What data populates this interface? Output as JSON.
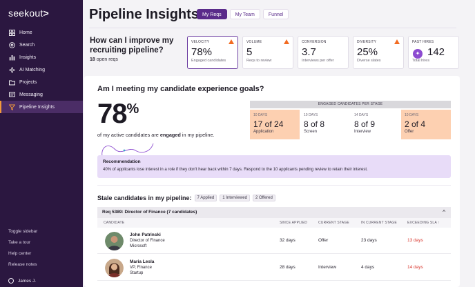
{
  "sidebar": {
    "logo": "seekout",
    "logo_mark": ">",
    "items": [
      {
        "label": "Home",
        "icon": "grid-icon"
      },
      {
        "label": "Search",
        "icon": "search-icon"
      },
      {
        "label": "Insights",
        "icon": "bar-chart-icon"
      },
      {
        "label": "AI Matching",
        "icon": "spark-icon"
      },
      {
        "label": "Projects",
        "icon": "folder-icon"
      },
      {
        "label": "Messaging",
        "icon": "message-icon"
      },
      {
        "label": "Pipeline Insights",
        "icon": "funnel-icon",
        "active": true
      }
    ],
    "bottom": [
      "Toggle sidebar",
      "Take a tour",
      "Help center",
      "Release notes"
    ],
    "user": "James J."
  },
  "header": {
    "title": "Pipeline Insights",
    "tabs": [
      "My Reqs",
      "My Team",
      "Funnel"
    ],
    "active_tab": "My Reqs"
  },
  "question": {
    "title": "How can I improve my recruiting pipeline?",
    "count": "18",
    "count_suffix": " open reqs"
  },
  "metrics": [
    {
      "label": "VELOCITY",
      "value": "78%",
      "sub": "Engaged candidates",
      "warn": true,
      "selected": true
    },
    {
      "label": "VOLUME",
      "value": "5",
      "sub": "Reqs to review",
      "warn": true
    },
    {
      "label": "CONVERSION",
      "value": "3.7",
      "sub": "Interviews per offer",
      "warn": false
    },
    {
      "label": "DIVERSITY",
      "value": "25%",
      "sub": "Diverse slates",
      "warn": true
    },
    {
      "label": "PAST HIRES",
      "value": "142",
      "sub": "Total hires",
      "warn": false
    }
  ],
  "experience": {
    "title": "Am I meeting my candidate experience goals?",
    "big_value": "78",
    "big_unit": "%",
    "text_before": "of my active candidates are ",
    "text_bold": "engaged",
    "text_after": " in my pipeline.",
    "stage_header": "ENGAGED CANDIDATES PER STAGE",
    "stages": [
      {
        "days": "10 DAYS",
        "value": "17 of 24",
        "name": "Application",
        "hot": true
      },
      {
        "days": "10 DAYS",
        "value": "8 of 8",
        "name": "Screen",
        "hot": false
      },
      {
        "days": "14 DAYS",
        "value": "8 of 9",
        "name": "Interview",
        "hot": false
      },
      {
        "days": "10 DAYS",
        "value": "2 of 4",
        "name": "Offer",
        "hot": true
      }
    ],
    "recommendation_title": "Recommendation",
    "recommendation_body": "40% of applicants lose interest in a role if they don't hear back within 7 days. Respond to the 10 applicants pending review to retain their interest."
  },
  "stale": {
    "title": "Stale candidates in my pipeline:",
    "chips": [
      "7 Applied",
      "1 Interviewed",
      "2 Offered"
    ],
    "req_label": "Req 5389: Director of Finance (7 candidates)",
    "columns": [
      "CANDIDATE",
      "SINCE APPLIED",
      "CURRENT STAGE",
      "IN CURRENT STAGE",
      "EXCEEDING SLA ↑"
    ],
    "rows": [
      {
        "name": "John Patrinski",
        "title": "Director of Finance",
        "company": "Microsoft",
        "since": "32 days",
        "stage": "Offer",
        "in_stage": "23 days",
        "sla": "13 days"
      },
      {
        "name": "Maria Lesla",
        "title": "VP, Finance",
        "company": "Startup",
        "since": "28 days",
        "stage": "Interview",
        "in_stage": "4 days",
        "sla": "14 days"
      }
    ]
  },
  "colors": {
    "sidebar": "#2b1740",
    "accent": "#5a2b8a",
    "warning": "#f26b21",
    "hot_stage": "#fdd0b1",
    "recommendation": "#e8dcf8",
    "sla_red": "#d8342b"
  }
}
